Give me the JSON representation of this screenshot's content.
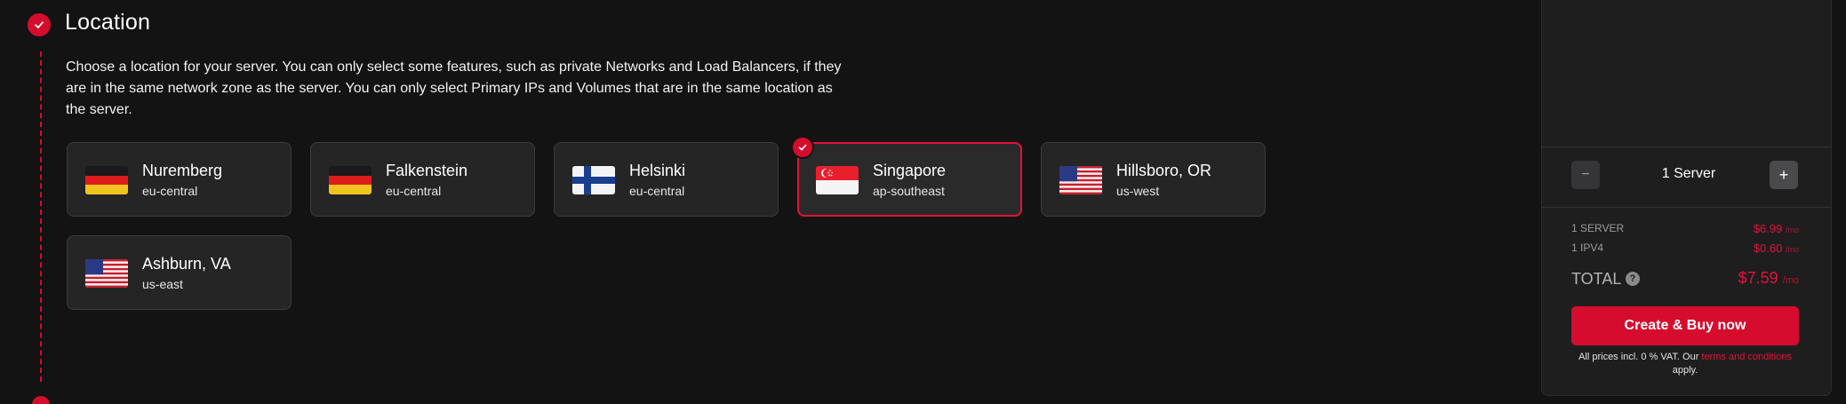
{
  "section": {
    "title": "Location",
    "description": "Choose a location for your server. You can only select some features, such as private Networks and Load Balancers, if they are in the same network zone as the server. You can only select Primary IPs and Volumes that are in the same location as the server."
  },
  "locations": [
    {
      "city": "Nuremberg",
      "zone": "eu-central",
      "flag": "germany-flag-icon",
      "selected": false
    },
    {
      "city": "Falkenstein",
      "zone": "eu-central",
      "flag": "germany-flag-icon",
      "selected": false
    },
    {
      "city": "Helsinki",
      "zone": "eu-central",
      "flag": "finland-flag-icon",
      "selected": false
    },
    {
      "city": "Singapore",
      "zone": "ap-southeast",
      "flag": "singapore-flag-icon",
      "selected": true
    },
    {
      "city": "Hillsboro, OR",
      "zone": "us-west",
      "flag": "usa-flag-icon",
      "selected": false
    },
    {
      "city": "Ashburn, VA",
      "zone": "us-east",
      "flag": "usa-flag-icon",
      "selected": false
    }
  ],
  "summary": {
    "quantity_label": "1 Server",
    "minus_symbol": "−",
    "plus_symbol": "+",
    "items": [
      {
        "label": "1 SERVER",
        "price": "$6.99",
        "per": "/mo"
      },
      {
        "label": "1 IPV4",
        "price": "$0.60",
        "per": "/mo"
      }
    ],
    "total_label": "TOTAL",
    "total_help": "?",
    "total_price": "$7.59",
    "total_per": "/mo",
    "buy_label": "Create & Buy now",
    "vat_prefix": "All prices incl. 0 % VAT. Our ",
    "vat_link": "terms and conditions",
    "vat_suffix": " apply."
  },
  "colors": {
    "accent": "#d50c2d",
    "background": "#131314",
    "card": "#252526"
  }
}
